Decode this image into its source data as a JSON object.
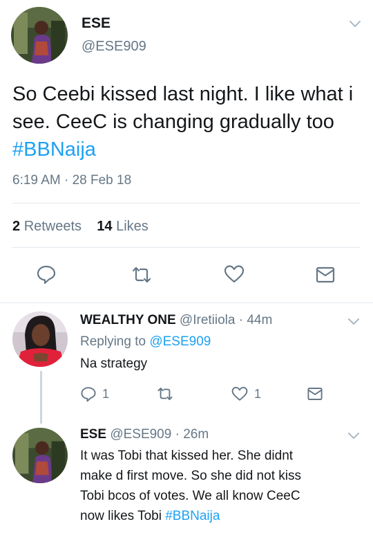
{
  "main_tweet": {
    "display_name": "ESE",
    "handle": "@ESE909",
    "text_plain": "So Ceebi kissed last night. I like what i see. CeeC is changing gradually too ",
    "hashtag": "#BBNaija",
    "timestamp": "6:19 AM · 28 Feb 18",
    "retweets_count": "2",
    "retweets_label": "Retweets",
    "likes_count": "14",
    "likes_label": "Likes"
  },
  "reply1": {
    "display_name": "WEALTHY ONE",
    "handle_time": "@Iretiiola · 44m",
    "replying_to_label": "Replying to",
    "replying_to_handle": "@ESE909",
    "text": "Na strategy",
    "reply_count": "1",
    "like_count": "1"
  },
  "reply2": {
    "display_name": "ESE",
    "handle_time": "@ESE909 · 26m",
    "text_lines": [
      "It was Tobi that kissed her. She didnt",
      "make d first move. So she did not kiss",
      "Tobi bcos of votes. We all know CeeC",
      "now likes Tobi "
    ],
    "hashtag": "#BBNaija"
  },
  "icons": {
    "reply": "reply-icon",
    "retweet": "retweet-icon",
    "like": "heart-icon",
    "dm": "envelope-icon",
    "more": "chevron-down-icon"
  },
  "colors": {
    "link": "#1da1f2",
    "secondary_text": "#657786",
    "divider": "#e1e8ed"
  }
}
